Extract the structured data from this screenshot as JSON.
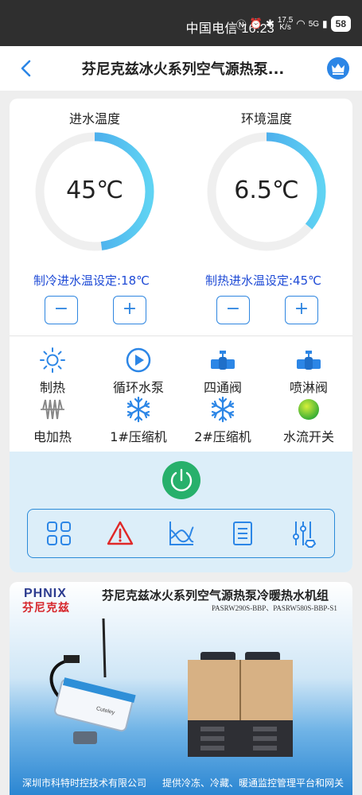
{
  "statusbar": {
    "carrier_time": "中国电信 16:23",
    "net_speed_top": "17.5",
    "net_speed_bottom": "K/s",
    "signal": "5G",
    "battery": "58"
  },
  "header": {
    "title": "芬尼克兹冰火系列空气源热泵..."
  },
  "gauges": [
    {
      "label": "进水温度",
      "value": "45℃",
      "level": 0.48
    },
    {
      "label": "环境温度",
      "value": "6.5℃",
      "level": 0.36
    }
  ],
  "settings": {
    "cooling": "制冷进水温设定:18℃",
    "heating": "制热进水温设定:45℃",
    "minus": "−",
    "plus": "+"
  },
  "status_items": [
    {
      "label": "制热",
      "icon": "sun-icon"
    },
    {
      "label": "循环水泵",
      "icon": "play-circle-icon"
    },
    {
      "label": "四通阀",
      "icon": "valve-icon"
    },
    {
      "label": "喷淋阀",
      "icon": "valve-icon"
    },
    {
      "label": "电加热",
      "icon": "heater-icon"
    },
    {
      "label": "1#压缩机",
      "icon": "snowflake-icon"
    },
    {
      "label": "2#压缩机",
      "icon": "snowflake-icon"
    },
    {
      "label": "水流开关",
      "icon": "green-dot-icon"
    }
  ],
  "toolbar": [
    "grid-icon",
    "warning-icon",
    "chart-icon",
    "list-icon",
    "sliders-icon"
  ],
  "banner": {
    "brand_en": "PHNIX",
    "brand_cn": "芬尼克兹",
    "title": "芬尼克兹冰火系列空气源热泵冷暖热水机组",
    "models": "PASRW290S-BBP、PASRW580S-BBP-S1",
    "company": "深圳市科特时控技术有限公司",
    "service": "提供冷冻、冷藏、暖通监控管理平台和网关",
    "device_label": "Cuteley"
  },
  "colors": {
    "accent": "#2c86e6",
    "setting_text": "#1f4bd6",
    "power": "#27b06b",
    "alarm": "#e02828"
  }
}
